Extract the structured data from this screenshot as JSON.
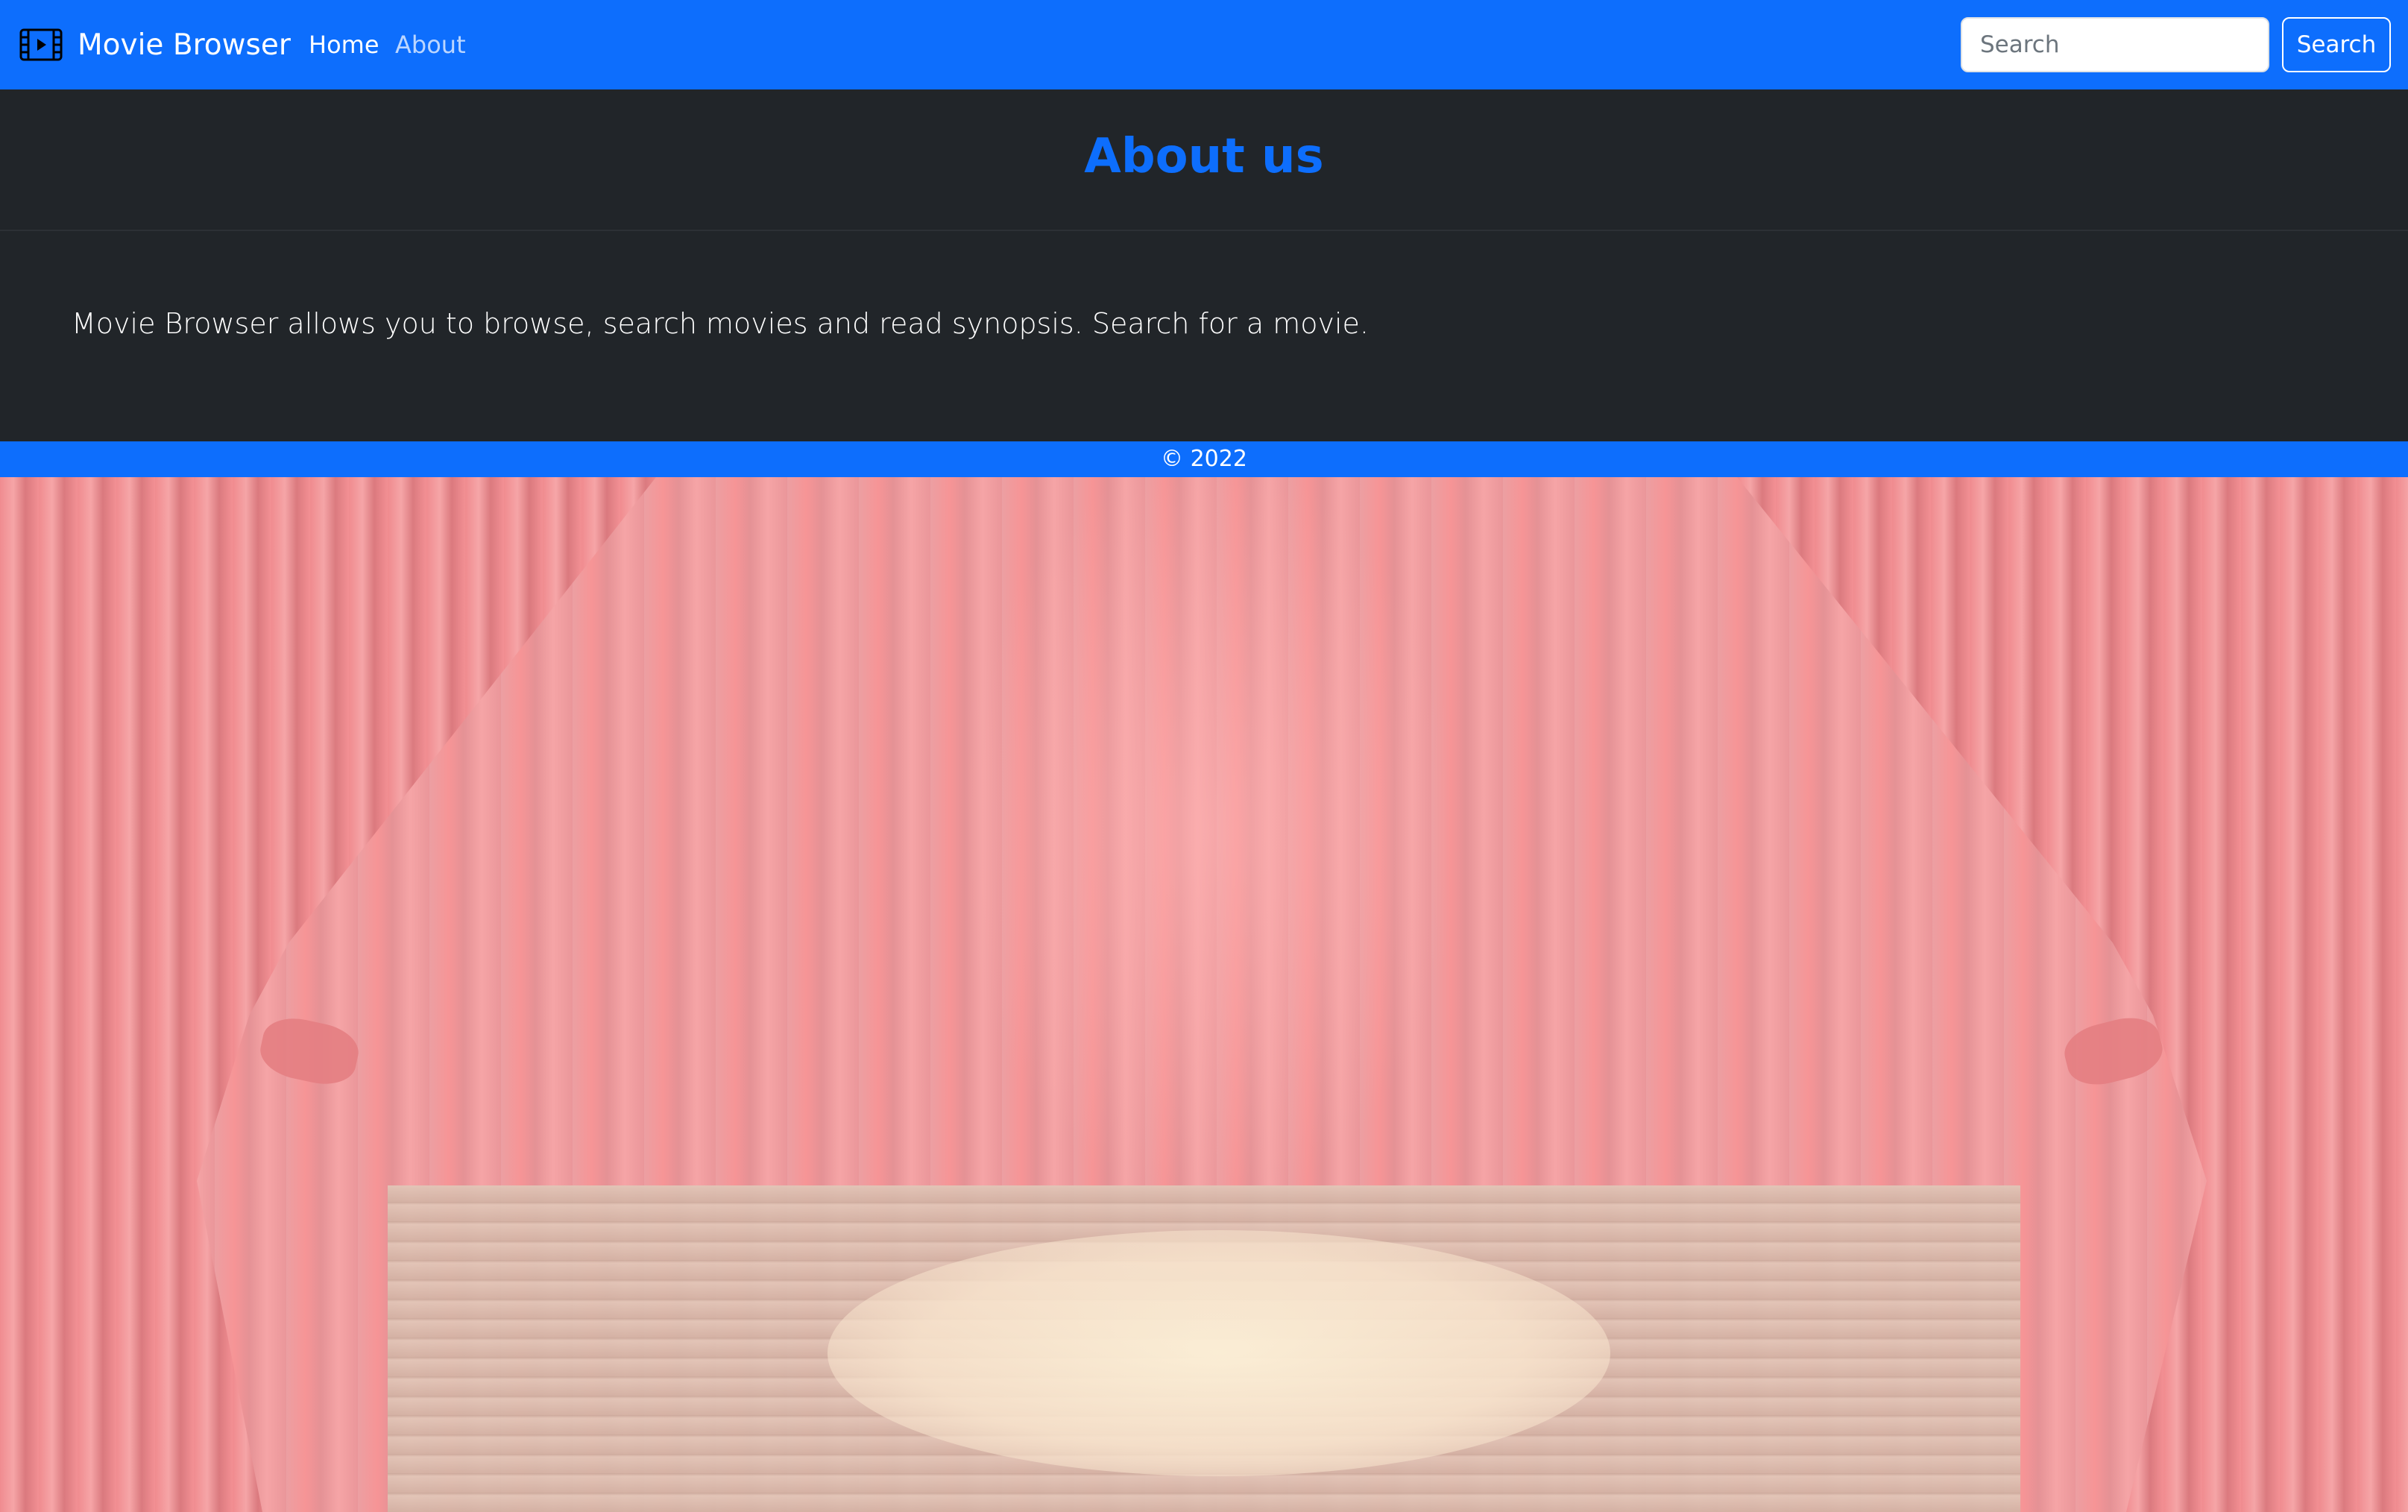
{
  "navbar": {
    "brand": "Movie Browser",
    "brand_icon": "film-icon",
    "links": [
      {
        "label": "Home",
        "active": true
      },
      {
        "label": "About",
        "active": false
      }
    ],
    "search": {
      "placeholder": "Search",
      "value": "",
      "button_label": "Search"
    }
  },
  "header": {
    "title": "About us"
  },
  "content": {
    "text": "Movie Browser allows you to browse, search movies and read synopsis. Search for a movie."
  },
  "footer": {
    "text": "© 2022"
  },
  "colors": {
    "primary": "#0d6efd",
    "dark": "#212529",
    "white": "#ffffff"
  },
  "background": {
    "icon": "stage-curtain-image"
  }
}
